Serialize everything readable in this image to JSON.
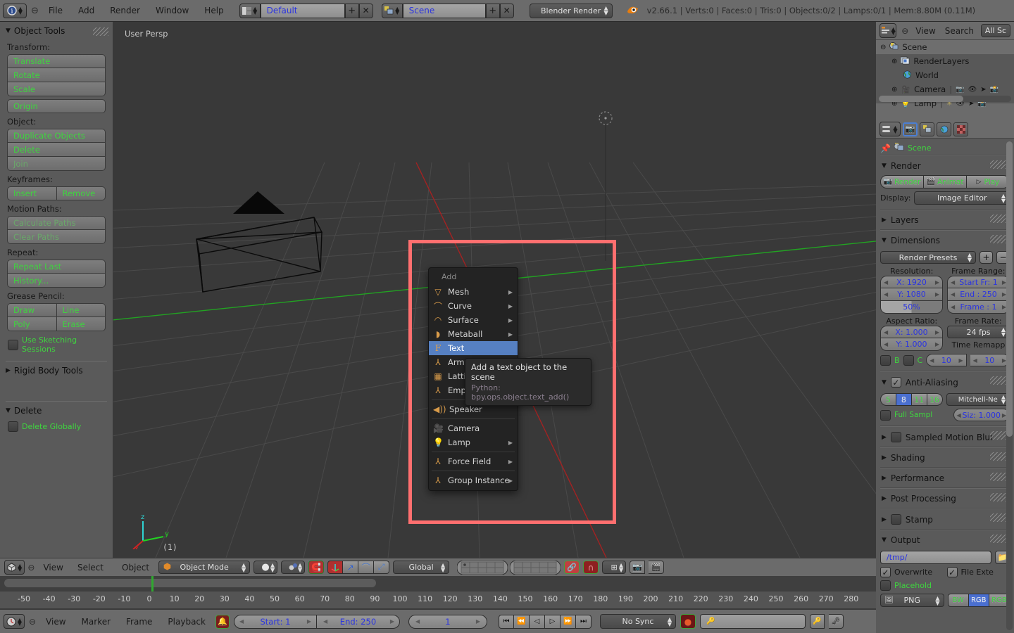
{
  "topbar": {
    "editor_icon": "info-editor-icon",
    "menus": [
      "File",
      "Add",
      "Render",
      "Window",
      "Help"
    ],
    "screen_layout": {
      "icon": "screen-layout-icon",
      "value": "Default",
      "add": "+",
      "remove": "x"
    },
    "scene": {
      "icon": "scene-icon",
      "value": "Scene",
      "add": "+",
      "remove": "x"
    },
    "engine": "Blender Render",
    "blender_icon": "blender-logo-icon",
    "stats": "v2.66.1 | Verts:0 | Faces:0 | Tris:0 | Objects:0/2 | Lamps:0/1 | Mem:8.80M (0.11M)"
  },
  "toolshelf": {
    "panel_title": "Object Tools",
    "sections": [
      {
        "label": "Transform:",
        "groups": [
          [
            "Translate",
            "Rotate",
            "Scale"
          ],
          [
            "Origin"
          ]
        ]
      },
      {
        "label": "Object:",
        "groups": [
          [
            "Duplicate Objects",
            "Delete",
            "Join"
          ]
        ]
      },
      {
        "label": "Keyframes:",
        "row": [
          "Insert",
          "Remove"
        ]
      },
      {
        "label": "Motion Paths:",
        "groups": [
          [
            "Calculate Paths",
            "Clear Paths"
          ]
        ]
      },
      {
        "label": "Repeat:",
        "groups": [
          [
            "Repeat Last",
            "History..."
          ]
        ]
      },
      {
        "label": "Grease Pencil:",
        "rows": [
          [
            "Draw",
            "Line"
          ],
          [
            "Poly",
            "Erase"
          ]
        ]
      }
    ],
    "disabled_buttons": [
      "Join",
      "Calculate Paths",
      "Clear Paths"
    ],
    "sketching_toggle": {
      "label": "Use Sketching Sessions",
      "checked": false
    },
    "rigid_body_panel": "Rigid Body Tools",
    "delete_panel": "Delete",
    "delete_globally": {
      "label": "Delete Globally",
      "checked": false
    }
  },
  "viewport": {
    "view_name": "User Persp",
    "layer_label": "(1)",
    "axis": {
      "x": "x",
      "y": "y",
      "z": "z"
    },
    "header": {
      "editor_icon": "3d-view-editor-icon",
      "menus": [
        "View",
        "Select",
        "Object"
      ],
      "mode": "Object Mode",
      "viewport_shading": "solid-shading-icon",
      "pivot": "pivot-icon",
      "snap_during_transform": "magnet-icon",
      "transform_orientation": "Global",
      "manipulator_icons": [
        "translate-manipulator-icon",
        "rotate-manipulator-icon",
        "scale-manipulator-icon"
      ],
      "layers_label": "scene-layers-grid",
      "proportional_edit": "proportional-edit-icon",
      "snap_element": "snap-element-icon",
      "render_icons": [
        "render-image-icon",
        "render-animation-icon"
      ]
    }
  },
  "add_menu": {
    "title": "Add",
    "items": [
      {
        "label": "Mesh",
        "icon": "mesh-icon",
        "submenu": true,
        "accel": "M"
      },
      {
        "label": "Curve",
        "icon": "curve-icon",
        "submenu": true,
        "accel": "C"
      },
      {
        "label": "Surface",
        "icon": "surface-icon",
        "submenu": true,
        "accel": "S"
      },
      {
        "label": "Metaball",
        "icon": "metaball-icon",
        "submenu": true,
        "accel": "M"
      },
      {
        "label": "Text",
        "icon": "text-icon",
        "submenu": false,
        "accel": "T",
        "selected": true
      },
      {
        "label": "Armature",
        "icon": "armature-icon",
        "submenu": true,
        "accel": "A"
      },
      {
        "label": "Lattice",
        "icon": "lattice-icon",
        "submenu": false,
        "accel": "L"
      },
      {
        "label": "Empty",
        "icon": "empty-icon",
        "submenu": true,
        "accel": "E"
      },
      {
        "label": "Speaker",
        "icon": "speaker-icon",
        "submenu": false,
        "accel": "p"
      },
      {
        "label": "Camera",
        "icon": "camera-icon",
        "submenu": false,
        "accel": "a"
      },
      {
        "label": "Lamp",
        "icon": "lamp-icon",
        "submenu": true,
        "accel": ""
      },
      {
        "label": "Force Field",
        "icon": "force-field-icon",
        "submenu": true,
        "accel": "F"
      },
      {
        "label": "Group Instance",
        "icon": "group-instance-icon",
        "submenu": true,
        "accel": "G"
      }
    ]
  },
  "tooltip": {
    "text": "Add a text object to the scene",
    "python": "Python: bpy.ops.object.text_add()"
  },
  "outliner": {
    "editor_icon": "outliner-editor-icon",
    "menus": [
      "View",
      "Search"
    ],
    "display_mode": "All Sc",
    "rows": [
      {
        "label": "Scene",
        "icon": "scene-icon",
        "indent": 0,
        "expander": "minus",
        "selected": true
      },
      {
        "label": "RenderLayers",
        "icon": "renderlayers-icon",
        "indent": 1,
        "expander": "plus"
      },
      {
        "label": "World",
        "icon": "world-icon",
        "indent": 1,
        "expander": ""
      },
      {
        "label": "Camera",
        "icon": "camera-icon",
        "indent": 1,
        "expander": "plus",
        "restrict": true
      },
      {
        "label": "Lamp",
        "icon": "lamp-icon",
        "indent": 1,
        "expander": "plus",
        "restrict": true
      }
    ]
  },
  "properties": {
    "tabs": [
      "render-tab-icon",
      "scene-tab-icon",
      "world-tab-icon",
      "texture-tab-icon"
    ],
    "active_tab": 0,
    "breadcrumb": {
      "pin_icon": "pin-icon",
      "icon": "scene-icon",
      "label": "Scene"
    },
    "render_panel": {
      "title": "Render",
      "buttons": [
        "Render",
        "Animat",
        "Play"
      ],
      "display_label": "Display:",
      "display_value": "Image Editor"
    },
    "layers_panel": "Layers",
    "dimensions_panel": {
      "title": "Dimensions",
      "presets": "Render Presets",
      "resolution_label": "Resolution:",
      "frame_range_label": "Frame Range:",
      "res_x": "X: 1920",
      "res_y": "Y: 1080",
      "res_percent": "50%",
      "start_frame": "Start Fr: 1",
      "end_frame": "End : 250",
      "current_frame": "Frame : 1",
      "aspect_label": "Aspect Ratio:",
      "frame_rate_label": "Frame Rate:",
      "aspect_x": "X: 1.000",
      "aspect_y": "Y: 1.000",
      "fps": "24 fps",
      "time_remap_label": "Time Remapp",
      "border_b": "B",
      "border_c": "C",
      "remap_old": "10",
      "remap_new": "10"
    },
    "antialiasing_panel": {
      "title": "Anti-Aliasing",
      "checked": true,
      "samples": [
        "5",
        "8",
        "11",
        "16"
      ],
      "active_sample": "8",
      "filter": "Mitchell-Ne",
      "full_sample": "Full Sampl",
      "size": "Siz: 1.000"
    },
    "collapsed_panels": [
      "Sampled Motion Blur",
      "Shading",
      "Performance",
      "Post Processing",
      "Stamp"
    ],
    "output_panel": {
      "title": "Output",
      "path": "/tmp/",
      "folder_icon": "folder-icon",
      "overwrite": {
        "label": "Overwrite",
        "checked": true
      },
      "file_extensions": {
        "label": "File Exte",
        "checked": true
      },
      "placeholders": {
        "label": "Placehold",
        "checked": false
      },
      "format": "PNG",
      "color_modes": [
        "BW",
        "RGB",
        "RGB"
      ],
      "active_color_mode": "RGB"
    }
  },
  "timeline": {
    "editor_icon": "timeline-editor-icon",
    "menus": [
      "View",
      "Marker",
      "Frame",
      "Playback"
    ],
    "use_audio_icon": "audio-icon",
    "start": "Start: 1",
    "end": "End: 250",
    "current": "1",
    "transport": [
      "jump-start-icon",
      "play-reverse-icon",
      "play-backwards-icon",
      "play-forwards-icon",
      "next-keyframe-icon",
      "jump-end-icon"
    ],
    "sync_mode": "No Sync",
    "record_icon": "record-icon",
    "keying_set": "",
    "keying_icons": [
      "insert-keyframe-icon",
      "delete-keyframe-icon"
    ],
    "ticks": [
      "-50",
      "-40",
      "-30",
      "-20",
      "-10",
      "0",
      "10",
      "20",
      "30",
      "40",
      "50",
      "60",
      "70",
      "80",
      "90",
      "100",
      "110",
      "120",
      "130",
      "140",
      "150",
      "160",
      "170",
      "180",
      "190",
      "200",
      "210",
      "220",
      "230",
      "240",
      "250",
      "260",
      "270",
      "280"
    ]
  },
  "colors": {
    "accent_blue": "#5680c2",
    "value_blue": "#2b34e0",
    "operator_green": "#3fd43f",
    "highlight_red": "#ff6f6f",
    "panel_bg": "#5a5a5a",
    "header_bg": "#6b6b6b",
    "viewport_bg": "#393939"
  }
}
